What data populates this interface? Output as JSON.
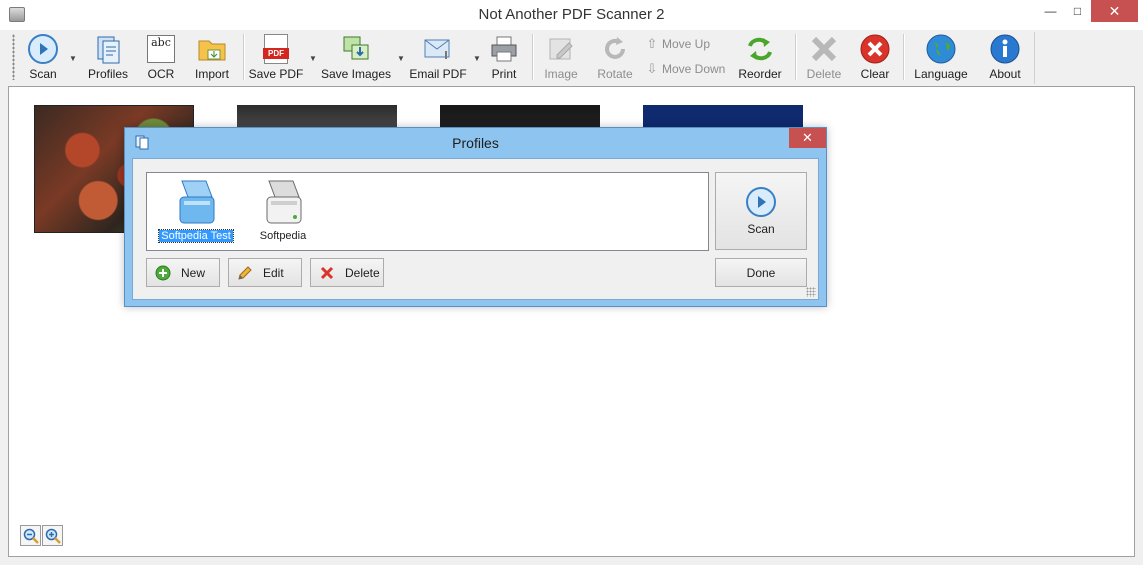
{
  "window": {
    "title": "Not Another PDF Scanner 2",
    "minimize_glyph": "—",
    "maximize_glyph": "□",
    "close_glyph": "✕"
  },
  "toolbar": {
    "scan": "Scan",
    "profiles": "Profiles",
    "ocr": "OCR",
    "ocr_icon_text": "abc",
    "import": "Import",
    "save_pdf": "Save PDF",
    "save_pdf_icon_text": "PDF",
    "save_images": "Save Images",
    "email_pdf": "Email PDF",
    "print": "Print",
    "image": "Image",
    "rotate": "Rotate",
    "move_up": "Move Up",
    "move_down": "Move Down",
    "reorder": "Reorder",
    "delete": "Delete",
    "clear": "Clear",
    "language": "Language",
    "about": "About"
  },
  "dialog": {
    "title": "Profiles",
    "close_glyph": "✕",
    "profiles": [
      {
        "label": "Softpedia Test",
        "selected": true
      },
      {
        "label": "Softpedia",
        "selected": false
      }
    ],
    "buttons": {
      "scan": "Scan",
      "done": "Done",
      "new": "New",
      "edit": "Edit",
      "delete": "Delete"
    }
  },
  "colors": {
    "dialog_frame": "#8ec5f0",
    "selection": "#3399ff",
    "close_red": "#c75050"
  }
}
